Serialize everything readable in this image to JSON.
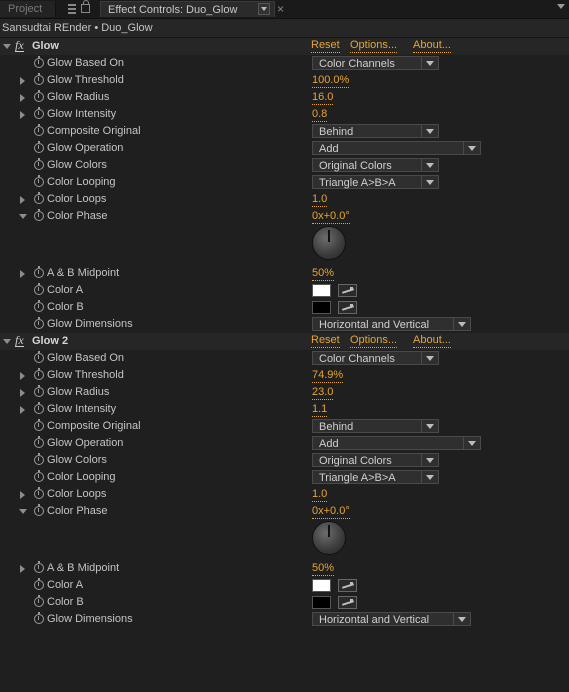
{
  "tabs": {
    "project": "Project",
    "active": "Effect Controls: Duo_Glow"
  },
  "breadcrumb": "Sansudtai REnder • Duo_Glow",
  "fx_label": "fx",
  "links": {
    "reset": "Reset",
    "options": "Options...",
    "about": "About..."
  },
  "effects": [
    {
      "name": "Glow",
      "glow_based_on": {
        "label": "Glow Based On",
        "value": "Color Channels"
      },
      "glow_threshold": {
        "label": "Glow Threshold",
        "value": "100.0%"
      },
      "glow_radius": {
        "label": "Glow Radius",
        "value": "16.0"
      },
      "glow_intensity": {
        "label": "Glow Intensity",
        "value": "0.8"
      },
      "composite_original": {
        "label": "Composite Original",
        "value": "Behind"
      },
      "glow_operation": {
        "label": "Glow Operation",
        "value": "Add"
      },
      "glow_colors": {
        "label": "Glow Colors",
        "value": "Original Colors"
      },
      "color_looping": {
        "label": "Color Looping",
        "value": "Triangle A>B>A"
      },
      "color_loops": {
        "label": "Color Loops",
        "value": "1.0"
      },
      "color_phase": {
        "label": "Color Phase",
        "value": "0x+0.0°"
      },
      "ab_midpoint": {
        "label": "A & B Midpoint",
        "value": "50%"
      },
      "color_a": {
        "label": "Color A",
        "color": "#ffffff"
      },
      "color_b": {
        "label": "Color B",
        "color": "#000000"
      },
      "glow_dimensions": {
        "label": "Glow Dimensions",
        "value": "Horizontal and Vertical"
      }
    },
    {
      "name": "Glow 2",
      "glow_based_on": {
        "label": "Glow Based On",
        "value": "Color Channels"
      },
      "glow_threshold": {
        "label": "Glow Threshold",
        "value": "74.9%"
      },
      "glow_radius": {
        "label": "Glow Radius",
        "value": "23.0"
      },
      "glow_intensity": {
        "label": "Glow Intensity",
        "value": "1.1"
      },
      "composite_original": {
        "label": "Composite Original",
        "value": "Behind"
      },
      "glow_operation": {
        "label": "Glow Operation",
        "value": "Add"
      },
      "glow_colors": {
        "label": "Glow Colors",
        "value": "Original Colors"
      },
      "color_looping": {
        "label": "Color Looping",
        "value": "Triangle A>B>A"
      },
      "color_loops": {
        "label": "Color Loops",
        "value": "1.0"
      },
      "color_phase": {
        "label": "Color Phase",
        "value": "0x+0.0°"
      },
      "ab_midpoint": {
        "label": "A & B Midpoint",
        "value": "50%"
      },
      "color_a": {
        "label": "Color A",
        "color": "#ffffff"
      },
      "color_b": {
        "label": "Color B",
        "color": "#000000"
      },
      "glow_dimensions": {
        "label": "Glow Dimensions",
        "value": "Horizontal and Vertical"
      }
    }
  ],
  "colors": {
    "accent": "#e8a531",
    "background": "#1f1f1f"
  }
}
